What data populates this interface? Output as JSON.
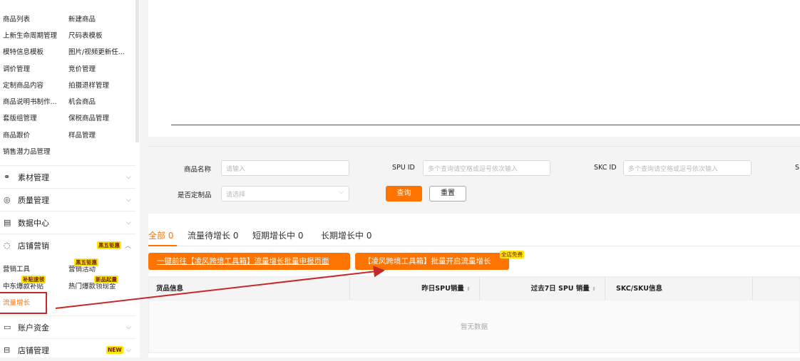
{
  "sidebar": {
    "sub_items": [
      "商品列表",
      "新建商品",
      "上新生命周期管理",
      "尺码表模板",
      "模特信息模板",
      "图片/视频更新任...",
      "调价管理",
      "竞价管理",
      "定制商品内容",
      "拍摄退样管理",
      "商品说明书制作...",
      "机会商品",
      "套版组管理",
      "保税商品管理",
      "商品跟价",
      "样品管理",
      "销售潜力品管理"
    ],
    "groups": [
      {
        "label": "素材管理",
        "icon": "material-icon"
      },
      {
        "label": "质量管理",
        "icon": "shield-check-icon"
      },
      {
        "label": "数据中心",
        "icon": "data-icon"
      },
      {
        "label": "店铺营销",
        "icon": "tag-icon",
        "badge": "黑五钜惠"
      }
    ],
    "marketing": [
      {
        "label": "营销工具"
      },
      {
        "label": "营销活动",
        "badge": "黑五钜惠"
      },
      {
        "label": "中东爆款补贴",
        "badge": "补贴速领"
      },
      {
        "label": "热门爆款领现金",
        "badge": "新品起量"
      },
      {
        "label": "流量增长"
      }
    ],
    "groups_bottom": [
      {
        "label": "账户资金",
        "icon": "wallet-icon"
      },
      {
        "label": "店铺管理",
        "icon": "store-icon",
        "badge": "NEW"
      }
    ]
  },
  "filter": {
    "name_label": "商品名称",
    "name_placeholder": "请输入",
    "spu_label": "SPU ID",
    "spu_placeholder": "多个查询请空格或逗号依次输入",
    "skc_label": "SKC ID",
    "skc_placeholder": "多个查询请空格或逗号依次输入",
    "sku_label_partial": "S",
    "custom_label": "是否定制品",
    "custom_placeholder": "请选择",
    "query": "查询",
    "reset": "重置"
  },
  "tabs": [
    "全部 0",
    "流量待增长 0",
    "短期增长中 0",
    "长期增长中 0"
  ],
  "actions": {
    "btn1": "一键前往【凌风跨境工具箱】流量增长批量申报页面",
    "btn2": "【凌风跨境工具箱】批量开启流量增长",
    "btn2_badge": "全店免费"
  },
  "table": {
    "headers": [
      "货品信息",
      "昨日SPU销量",
      "过去7日 SPU 销量",
      "SKC/SKU信息"
    ],
    "empty": "暂无数据"
  },
  "colors": {
    "accent": "#ff7300",
    "badge": "#ffe600",
    "annotation": "#c62828"
  }
}
